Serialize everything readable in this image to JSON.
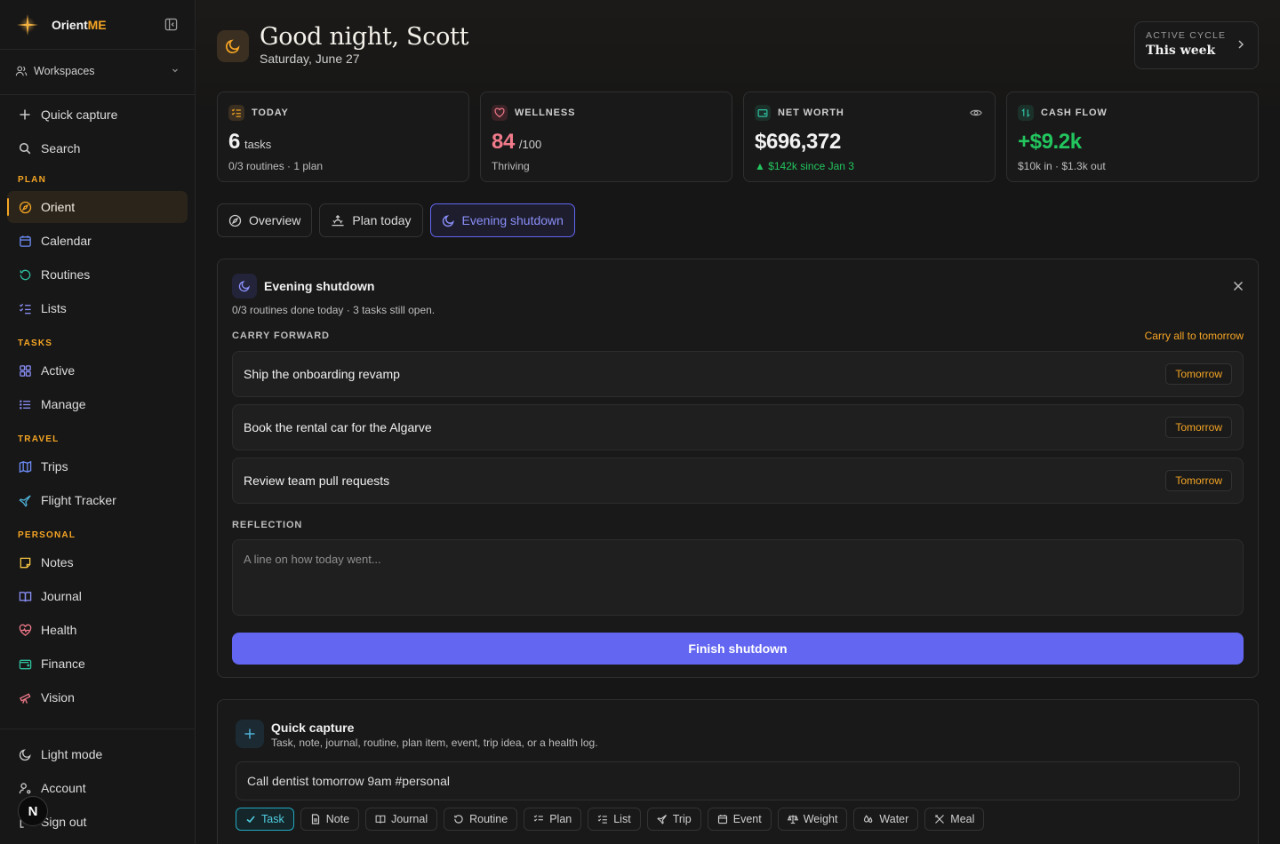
{
  "brand": {
    "name_main": "Orient",
    "name_accent": "ME"
  },
  "sidebar": {
    "workspaces_label": "Workspaces",
    "quick_capture": "Quick capture",
    "search": "Search",
    "sections": [
      {
        "title": "PLAN",
        "items": [
          "Orient",
          "Calendar",
          "Routines",
          "Lists"
        ]
      },
      {
        "title": "TASKS",
        "items": [
          "Active",
          "Manage"
        ]
      },
      {
        "title": "TRAVEL",
        "items": [
          "Trips",
          "Flight Tracker"
        ]
      },
      {
        "title": "PERSONAL",
        "items": [
          "Notes",
          "Journal",
          "Health",
          "Finance",
          "Vision"
        ]
      }
    ],
    "bottom": [
      "Light mode",
      "Account",
      "Sign out"
    ],
    "avatar_letter": "N",
    "active_item": "Orient"
  },
  "header": {
    "greeting": "Good night, Scott",
    "date": "Saturday, June 27",
    "cycle_label": "ACTIVE CYCLE",
    "cycle_value": "This week"
  },
  "stats": [
    {
      "label": "TODAY",
      "value": "6",
      "unit": "tasks",
      "sub": "0/3 routines · 1 plan",
      "color": "#f2f2f2"
    },
    {
      "label": "WELLNESS",
      "value": "84",
      "unit": "/100",
      "sub": "Thriving",
      "color": "#f07a8a"
    },
    {
      "label": "NET WORTH",
      "value": "$696,372",
      "unit": "",
      "sub": "▲ $142k since Jan 3",
      "color": "#f2f2f2",
      "sub_color": "#22c55e"
    },
    {
      "label": "CASH FLOW",
      "value": "+$9.2k",
      "unit": "",
      "sub": "$10k in · $1.3k out",
      "color": "#22c55e"
    }
  ],
  "tabs": [
    "Overview",
    "Plan today",
    "Evening shutdown"
  ],
  "shutdown": {
    "title": "Evening shutdown",
    "subtitle": "0/3 routines done today · 3 tasks still open.",
    "carry_label": "CARRY FORWARD",
    "carry_all": "Carry all to tomorrow",
    "items": [
      {
        "title": "Ship the onboarding revamp",
        "action": "Tomorrow"
      },
      {
        "title": "Book the rental car for the Algarve",
        "action": "Tomorrow"
      },
      {
        "title": "Review team pull requests",
        "action": "Tomorrow"
      }
    ],
    "reflection_label": "REFLECTION",
    "reflection_placeholder": "A line on how today went...",
    "finish_label": "Finish shutdown"
  },
  "capture": {
    "title": "Quick capture",
    "subtitle": "Task, note, journal, routine, plan item, event, trip idea, or a health log.",
    "input_value": "Call dentist tomorrow 9am #personal",
    "chips": [
      "Task",
      "Note",
      "Journal",
      "Routine",
      "Plan",
      "List",
      "Trip",
      "Event",
      "Weight",
      "Water",
      "Meal"
    ],
    "active_chip": "Task"
  },
  "colors": {
    "accent": "#f5a524",
    "indigo": "#6366f1",
    "green": "#22c55e",
    "teal": "#22a8c0"
  }
}
